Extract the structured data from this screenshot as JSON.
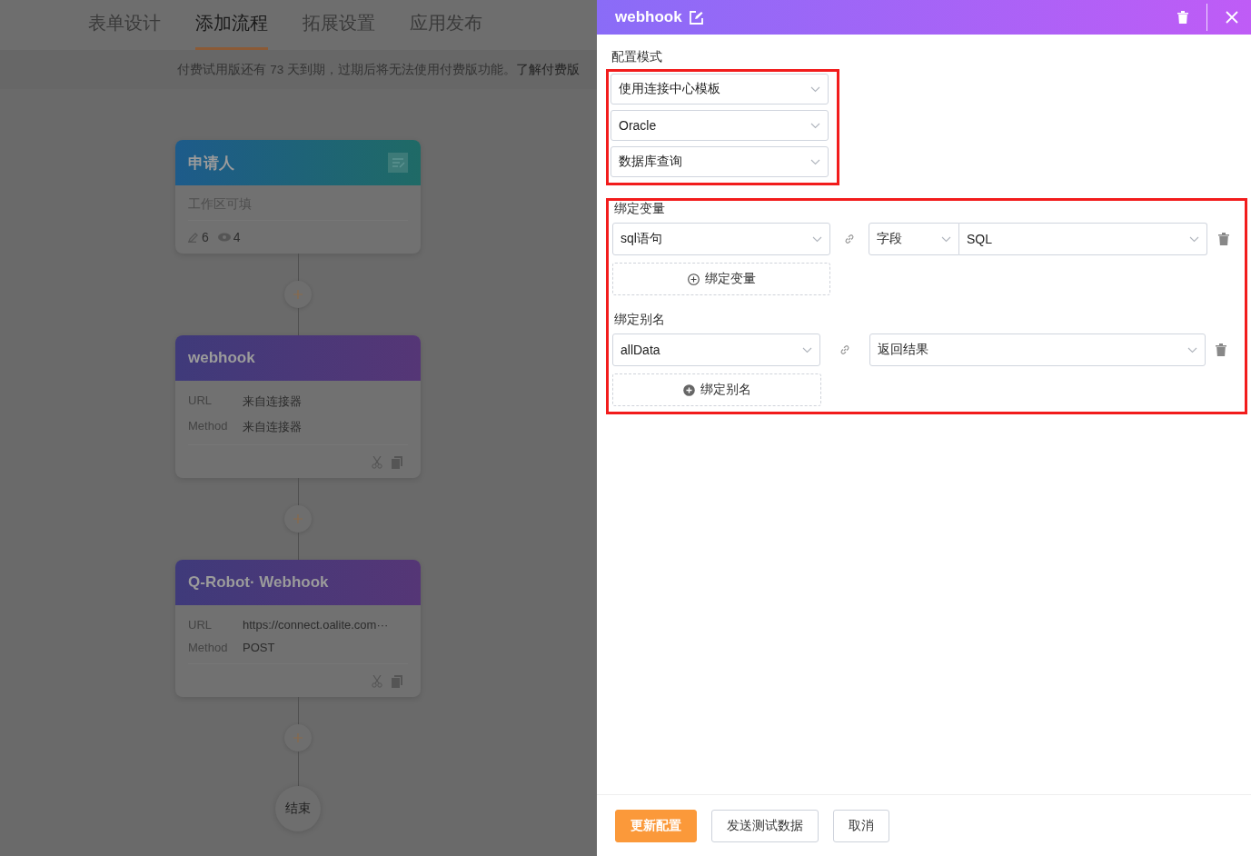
{
  "tabs": [
    {
      "label": "表单设计",
      "selected": false
    },
    {
      "label": "添加流程",
      "selected": true
    },
    {
      "label": "拓展设置",
      "selected": false
    },
    {
      "label": "应用发布",
      "selected": false
    }
  ],
  "notice": {
    "text": "付费试用版还有 73 天到期，过期后将无法使用付费版功能。",
    "link": "了解付费版"
  },
  "flow": {
    "nodes": [
      {
        "kind": "applicant",
        "title": "申请人",
        "subtitle": "工作区可填",
        "edit_count": "6",
        "view_count": "4"
      },
      {
        "kind": "action",
        "title": "webhook",
        "fields": [
          {
            "label": "URL",
            "value": "来自连接器"
          },
          {
            "label": "Method",
            "value": "来自连接器"
          }
        ]
      },
      {
        "kind": "action",
        "title": "Q-Robot· Webhook",
        "fields": [
          {
            "label": "URL",
            "value": "https://connect.oalite.com···"
          },
          {
            "label": "Method",
            "value": "POST"
          }
        ]
      }
    ],
    "end": "结束"
  },
  "drawer": {
    "title": "webhook",
    "config_mode": {
      "label": "配置模式",
      "highlighted": true,
      "selects": [
        "使用连接中心模板",
        "Oracle",
        "数据库查询"
      ]
    },
    "mapping": {
      "highlighted": true,
      "variables": {
        "label": "绑定变量",
        "rows": [
          {
            "source": "sql语句",
            "field_type": "字段",
            "field": "SQL"
          }
        ],
        "add_label": "绑定变量"
      },
      "aliases": {
        "label": "绑定别名",
        "rows": [
          {
            "source": "allData",
            "target": "返回结果"
          }
        ],
        "add_label": "绑定别名"
      }
    },
    "buttons": [
      {
        "label": "更新配置",
        "kind": "primary"
      },
      {
        "label": "发送测试数据",
        "kind": "default"
      },
      {
        "label": "取消",
        "kind": "default"
      }
    ]
  }
}
